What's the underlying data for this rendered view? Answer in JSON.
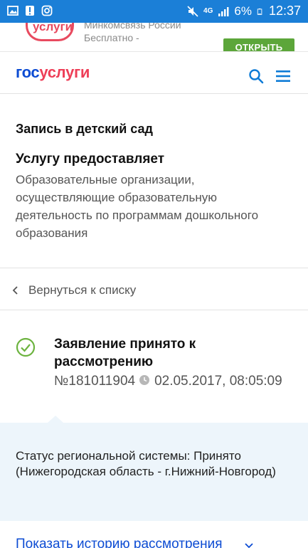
{
  "status_bar": {
    "network": "4G",
    "battery": "6%",
    "time": "12:37",
    "icons": [
      "image-icon",
      "alert-icon",
      "instagram-icon",
      "mute-icon",
      "signal-icon",
      "battery-icon"
    ]
  },
  "banner": {
    "logo_text": "услуги",
    "line1": "Минкомсвязь России",
    "line2": "Бесплатно -",
    "open_button": "ОТКРЫТЬ"
  },
  "header": {
    "logo_part1": "гос",
    "logo_part2": "услуги",
    "icons": [
      "search-icon",
      "menu-icon"
    ]
  },
  "service": {
    "title": "Запись в детский сад",
    "provider_label": "Услугу предоставляет",
    "provider": "Образовательные организации, осуществляющие образовательную деятельность по программам дошкольного образования"
  },
  "back_link": {
    "label": "Вернуться к списку"
  },
  "application": {
    "status_title": "Заявление принято к рассмотрению",
    "number": "№181011904",
    "datetime": "02.05.2017, 08:05:09"
  },
  "regional": {
    "text": "Статус региональной системы: Принято (Нижегородская область - г.Нижний-Новгород)"
  },
  "history_link": {
    "label": "Показать историю рассмотрения"
  },
  "colors": {
    "status_bar": "#1b7fd7",
    "brand_blue": "#0d4cd3",
    "brand_red": "#ee3f58",
    "success_green": "#6cb33f",
    "panel_bg": "#edf5fb"
  }
}
